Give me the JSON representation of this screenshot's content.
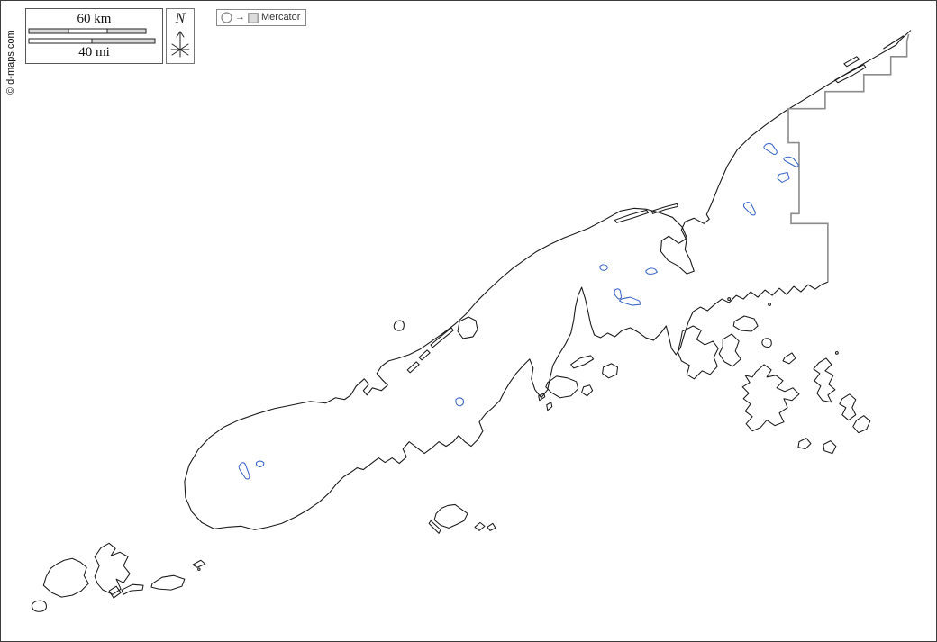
{
  "scale_bar": {
    "km_label": "60 km",
    "mi_label": "40 mi"
  },
  "compass": {
    "label": "N"
  },
  "projection": {
    "label": "Mercator",
    "arrow": "→"
  },
  "credit": {
    "label": "© d-maps.com"
  },
  "map": {
    "type": "blank-outline-map",
    "colors": {
      "coastline": "#1a1a1a",
      "boundary": "#8c8c8c",
      "lake": "#3a66c8",
      "scale_fill": "#d9d9d9",
      "frame": "#3c3c3c"
    }
  }
}
